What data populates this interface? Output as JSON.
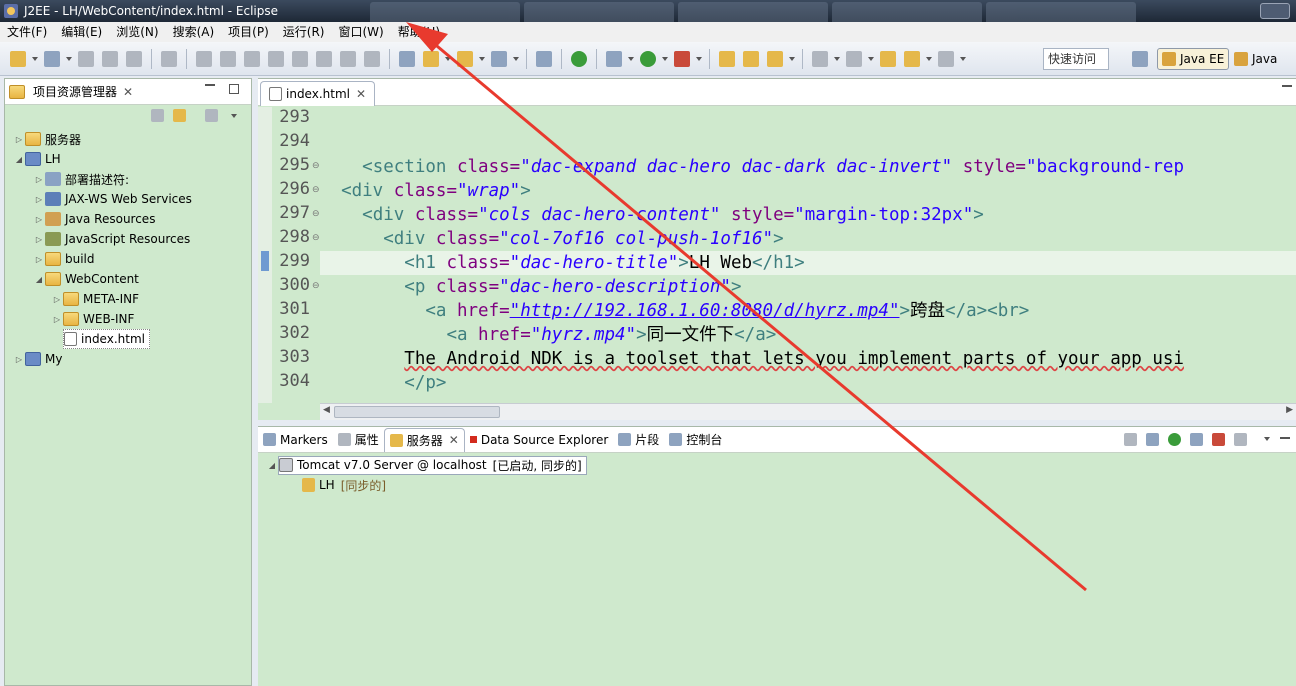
{
  "window": {
    "title": "J2EE - LH/WebContent/index.html - Eclipse"
  },
  "menu": [
    "文件(F)",
    "编辑(E)",
    "浏览(N)",
    "搜索(A)",
    "项目(P)",
    "运行(R)",
    "窗口(W)",
    "帮助(H)"
  ],
  "toolbar": {
    "quick_access": "快速访问",
    "perspective_javaee": "Java EE",
    "perspective_java": "Java"
  },
  "project_explorer": {
    "title": "项目资源管理器",
    "items": [
      {
        "label": "服务器",
        "icon": "folder-icon"
      },
      {
        "label": "LH",
        "icon": "project-icon"
      },
      {
        "label": "部署描述符:",
        "icon": "descriptor-icon"
      },
      {
        "label": "JAX-WS Web Services",
        "icon": "webservices-icon"
      },
      {
        "label": "Java Resources",
        "icon": "java-resources-icon"
      },
      {
        "label": "JavaScript Resources",
        "icon": "javascript-resources-icon"
      },
      {
        "label": "build",
        "icon": "folder-icon"
      },
      {
        "label": "WebContent",
        "icon": "folder-icon"
      },
      {
        "label": "META-INF",
        "icon": "folder-icon"
      },
      {
        "label": "WEB-INF",
        "icon": "folder-icon"
      },
      {
        "label": "index.html",
        "icon": "html-file-icon"
      },
      {
        "label": "My",
        "icon": "project-icon"
      }
    ]
  },
  "editor": {
    "tab": "index.html",
    "line_numbers": [
      "293",
      "294",
      "295",
      "296",
      "297",
      "298",
      "299",
      "300",
      "301",
      "302",
      "303",
      "304"
    ],
    "lines": {
      "l295": {
        "tag": "<section",
        "attr": " class=",
        "value": "\"dac-expand dac-hero dac-dark dac-invert\"",
        "attr2": " style=",
        "value2": "\"background-rep"
      },
      "l296": {
        "tag": "<div",
        "attr": " class=",
        "value": "\"wrap\"",
        "end": ">"
      },
      "l297": {
        "tag": "<div",
        "attr": " class=",
        "value": "\"cols dac-hero-content\"",
        "attr2": " style=",
        "value2": "\"margin-top:32px\"",
        "end": ">"
      },
      "l298": {
        "tag": "<div",
        "attr": " class=",
        "value": "\"col-7of16 col-push-1of16\"",
        "end": ">"
      },
      "l299": {
        "tag": "<h1",
        "attr": " class=",
        "value": "\"dac-hero-title\"",
        "end": ">",
        "text": "LH Web",
        "close": "</h1>"
      },
      "l300": {
        "tag": "<p",
        "attr": " class=",
        "value": "\"dac-hero-description\"",
        "end": ">"
      },
      "l301": {
        "tag": "<a",
        "attr": " href=",
        "value": "\"http://192.168.1.60:8080/d/hyrz.mp4\"",
        "end": ">",
        "text": "跨盘",
        "close": "</a><br>"
      },
      "l302": {
        "tag": "<a",
        "attr": " href=",
        "value": "\"hyrz.mp4\"",
        "end": ">",
        "text": "同一文件下",
        "close": "</a>"
      },
      "l303": {
        "text": "The Android NDK is a toolset that lets you implement parts of your app usi"
      },
      "l304": {
        "close": "</p>"
      }
    }
  },
  "bottom_panel": {
    "tabs": [
      "Markers",
      "属性",
      "服务器",
      "Data Source Explorer",
      "片段",
      "控制台"
    ],
    "server": {
      "name": "Tomcat v7.0 Server @ localhost",
      "state": "[已启动, 同步的]"
    },
    "module": {
      "name": "LH",
      "state": "[同步的]"
    }
  },
  "colors": {
    "panel_bg": "#cfe9cd",
    "annotation_arrow": "#e83a2e"
  }
}
